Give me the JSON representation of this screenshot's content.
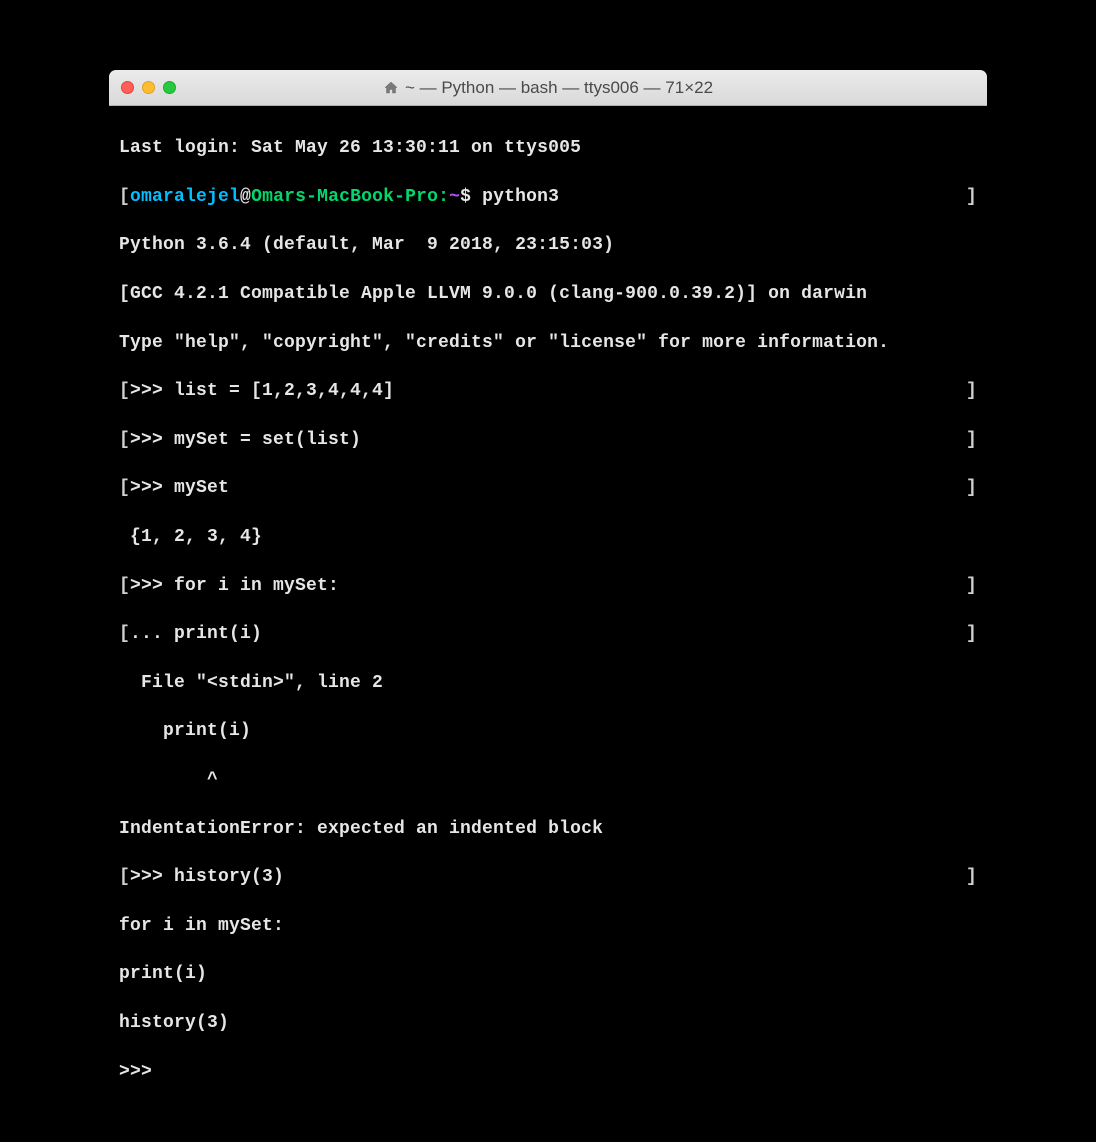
{
  "window": {
    "title": "~ — Python — bash — ttys006 — 71×22"
  },
  "terminal": {
    "lastLogin": "Last login: Sat May 26 13:30:11 on ttys005",
    "prompt": {
      "user": "omaralejel",
      "host": "Omars-MacBook-Pro",
      "path": "~",
      "command": "python3"
    },
    "pythonHeader": {
      "line1": "Python 3.6.4 (default, Mar  9 2018, 23:15:03) ",
      "line2": "[GCC 4.2.1 Compatible Apple LLVM 9.0.0 (clang-900.0.39.2)] on darwin",
      "line3": "Type \"help\", \"copyright\", \"credits\" or \"license\" for more information."
    },
    "session": {
      "l1": ">>> list = [1,2,3,4,4,4]",
      "l2": ">>> mySet = set(list)",
      "l3": ">>> mySet",
      "l4": " {1, 2, 3, 4}",
      "l5": ">>> for i in mySet:",
      "l6": "... print(i)",
      "l7": "  File \"<stdin>\", line 2",
      "l8": "    print(i)",
      "l9": "        ^",
      "l10": "IndentationError: expected an indented block",
      "l11": ">>> history(3)",
      "l12": "for i in mySet:",
      "l13": "print(i)",
      "l14": "history(3)",
      "l15": ">>> "
    },
    "brackets": {
      "open": "[",
      "close": "]"
    }
  }
}
